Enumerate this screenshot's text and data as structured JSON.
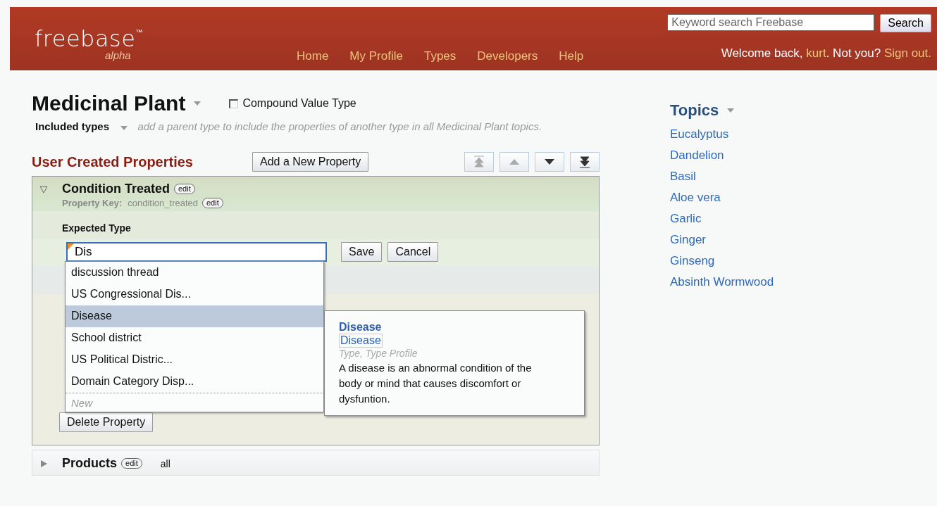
{
  "header": {
    "logo": "freebase",
    "trademark": "™",
    "edition": "alpha",
    "nav": [
      {
        "label": "Home"
      },
      {
        "label": "My Profile"
      },
      {
        "label": "Types"
      },
      {
        "label": "Developers"
      },
      {
        "label": "Help"
      }
    ],
    "search": {
      "placeholder": "Keyword search Freebase",
      "button": "Search"
    },
    "welcome": {
      "prefix": "Welcome back,",
      "user": "kurt",
      "middle": ". Not you?",
      "signout": "Sign out."
    }
  },
  "type": {
    "title": "Medicinal Plant",
    "compound": {
      "label": "Compound Value Type",
      "checked": false
    },
    "included_label": "Included types",
    "included_hint": "add a parent type to include the properties of another type in all Medicinal Plant topics."
  },
  "properties": {
    "title": "User Created Properties",
    "add_button": "Add a New Property",
    "items": [
      {
        "name": "Condition Treated",
        "expanded": true,
        "edit": "edit",
        "key_label": "Property Key:",
        "key": "condition_treated",
        "key_edit": "edit",
        "expected_type_label": "Expected Type",
        "value": "Dis",
        "save": "Save",
        "cancel": "Cancel",
        "suggestions": [
          {
            "label": "discussion thread",
            "selected": false
          },
          {
            "label": "US Congressional Dis...",
            "selected": false
          },
          {
            "label": "Disease",
            "selected": true
          },
          {
            "label": "School district",
            "selected": false
          },
          {
            "label": "US Political Distric...",
            "selected": false
          },
          {
            "label": "Domain Category Disp...",
            "selected": false
          }
        ],
        "new": "New",
        "delete": "Delete Property",
        "preview": {
          "title": "Disease",
          "link": "Disease",
          "meta": "Type, Type Profile",
          "description": "A disease is an abnormal condition of the body or mind that causes discomfort or dysfuntion."
        }
      },
      {
        "name": "Products",
        "expanded": false,
        "edit": "edit",
        "extra": "all"
      }
    ]
  },
  "topics": {
    "title": "Topics",
    "items": [
      "Eucalyptus",
      "Dandelion",
      "Basil",
      "Aloe vera",
      "Garlic",
      "Ginger",
      "Ginseng",
      "Absinth Wormwood"
    ]
  }
}
